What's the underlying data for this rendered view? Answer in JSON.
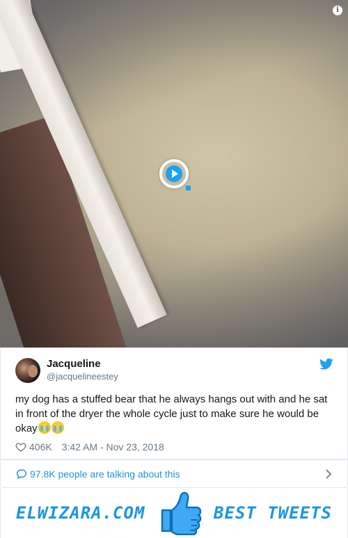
{
  "media": {
    "info_icon": "info-icon",
    "play_icon": "play-icon"
  },
  "tweet": {
    "display_name": "Jacqueline",
    "handle": "@jacquelineestey",
    "text": "my dog has a stuffed bear that he always hangs out with and he sat in front of the dryer the whole cycle just to make sure he would be okay",
    "emoji": [
      "crying-face-emoji",
      "crying-face-emoji"
    ],
    "likes": "406K",
    "timestamp": "3:42 AM - Nov 23, 2018",
    "brand_icon": "twitter-bird-icon"
  },
  "conversation": {
    "label": "97.8K people are talking about this"
  },
  "footer": {
    "left_text": "ELWIZARA.COM",
    "right_text": "BEST TWEETS",
    "icon": "thumbs-up-icon"
  },
  "colors": {
    "accent": "#1da1f2",
    "link": "#1b95e0",
    "text": "#14171a",
    "muted": "#657786",
    "border": "#e1e8ed"
  }
}
